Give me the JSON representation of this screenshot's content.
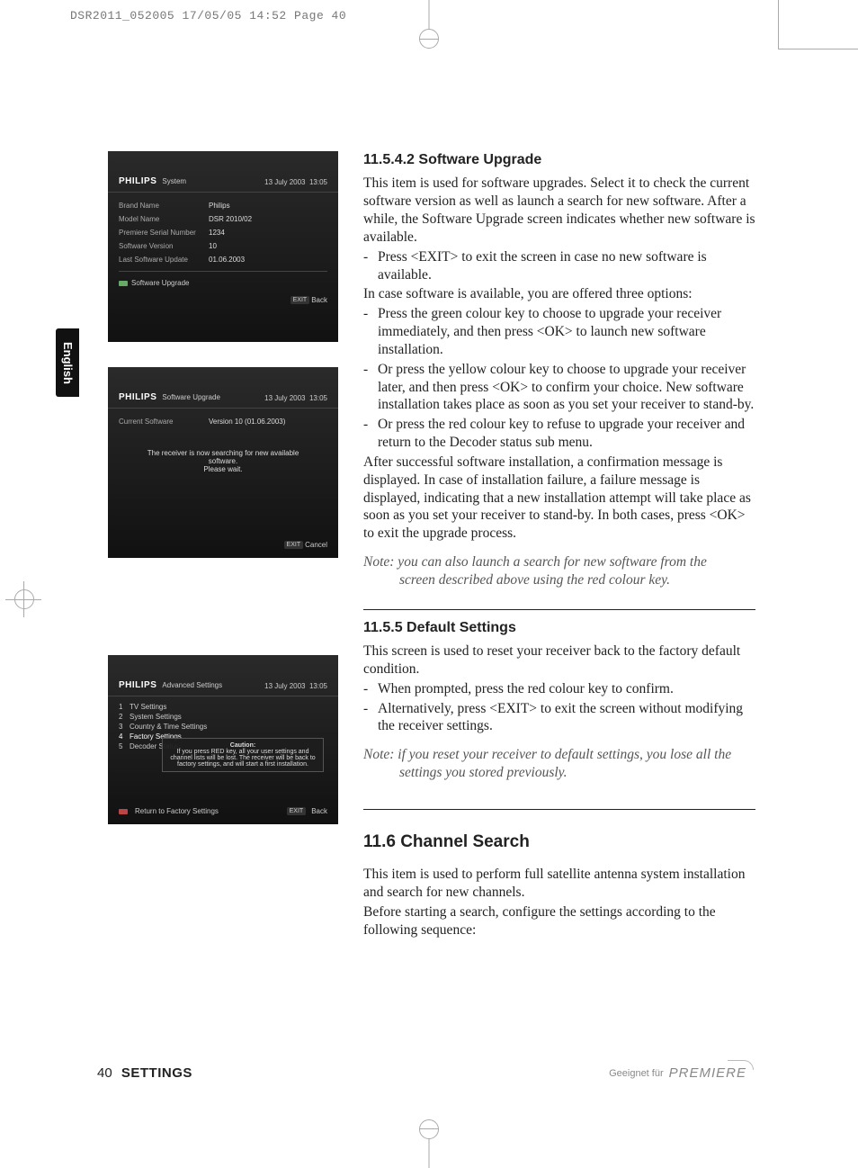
{
  "print_header": "DSR2011_052005  17/05/05  14:52  Page 40",
  "language_tab": "English",
  "shot1": {
    "brand": "PHILIPS",
    "crumb": "System",
    "date": "13 July 2003",
    "time": "13:05",
    "rows": [
      {
        "lbl": "Brand Name",
        "val": "Philips"
      },
      {
        "lbl": "Model Name",
        "val": "DSR 2010/02"
      },
      {
        "lbl": "Premiere Serial Number",
        "val": "1234"
      },
      {
        "lbl": "Software Version",
        "val": "10"
      },
      {
        "lbl": "Last Software Update",
        "val": "01.06.2003"
      }
    ],
    "software_upgrade": "Software Upgrade",
    "exit_btn": "EXIT",
    "back": "Back"
  },
  "shot2": {
    "brand": "PHILIPS",
    "crumb": "Software Upgrade",
    "date": "13 July 2003",
    "time": "13:05",
    "cur_label": "Current Software",
    "cur_val": "Version 10 (01.06.2003)",
    "msg_line1": "The receiver is now searching for new available software.",
    "msg_line2": "Please wait.",
    "exit_btn": "EXIT",
    "cancel": "Cancel"
  },
  "shot3": {
    "brand": "PHILIPS",
    "crumb": "Advanced Settings",
    "date": "13 July 2003",
    "time": "13:05",
    "menu": [
      {
        "n": "1",
        "t": "TV Settings"
      },
      {
        "n": "2",
        "t": "System Settings"
      },
      {
        "n": "3",
        "t": "Country & Time Settings"
      },
      {
        "n": "4",
        "t": "Factory Settings"
      },
      {
        "n": "5",
        "t": "Decoder Status"
      }
    ],
    "tooltip_title": "Caution:",
    "tooltip_body": "If you press RED key, all your user settings and channel lists will be lost. The receiver will be back to factory settings, and will start a first installation.",
    "return": "Return to Factory Settings",
    "exit_btn": "EXIT",
    "back": "Back"
  },
  "sec1": {
    "h": "11.5.4.2 Software Upgrade",
    "p1": "This item is used for software upgrades. Select it to check the current software version as well as launch a search for new software. After a while, the Software Upgrade screen indicates whether new software is available.",
    "b1": "Press <EXIT> to exit the screen in case no new software is available.",
    "p2": "In case software is available, you are offered three options:",
    "b2": "Press the green colour key to choose to upgrade your receiver immediately, and then press <OK> to launch new software installation.",
    "b3": "Or press the yellow colour key to choose to upgrade your receiver later, and then press <OK> to confirm your choice. New software installation takes place as soon as you set your receiver to stand-by.",
    "b4": "Or press the red colour key to refuse to upgrade your receiver and return to the Decoder status sub menu.",
    "p3": "After successful software installation, a confirmation message is displayed. In case of installation failure, a failure message is displayed, indicating that a new installation attempt will take place as soon as you set your receiver to stand-by. In both cases, press <OK> to exit the upgrade process.",
    "note_a": "Note: you can also launch a search for new software from the",
    "note_b": "screen described above using the red colour key."
  },
  "sec2": {
    "h": "11.5.5 Default Settings",
    "p1": "This screen is used to reset your receiver back to the factory default condition.",
    "b1": "When prompted, press the red colour key to confirm.",
    "b2": "Alternatively, press <EXIT> to exit the screen without modifying the receiver settings.",
    "note_a": "Note: if you reset your receiver to default settings, you lose all the",
    "note_b": "settings you stored previously."
  },
  "sec3": {
    "h": "11.6   Channel Search",
    "p1": "This item is used to perform full satellite antenna system installation and search for new channels.",
    "p2": "Before starting a search, configure the settings according to the following sequence:"
  },
  "footer": {
    "page": "40",
    "section": "SETTINGS",
    "suitable": "Geeignet für",
    "logo": "PREMIERE"
  }
}
